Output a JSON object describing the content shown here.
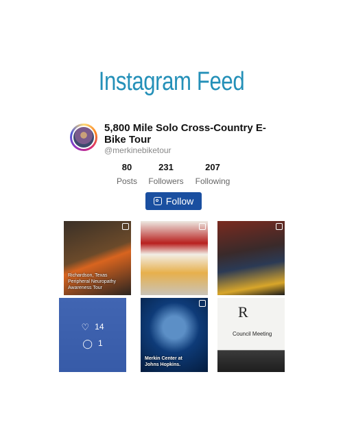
{
  "feed": {
    "title": "Instagram Feed"
  },
  "profile": {
    "name": "5,800 Mile Solo Cross-Country E-Bike Tour",
    "handle": "@merkinebiketour",
    "avatar_icon": "profile-avatar"
  },
  "stats": [
    {
      "value": "80",
      "label": "Posts"
    },
    {
      "value": "231",
      "label": "Followers"
    },
    {
      "value": "207",
      "label": "Following"
    }
  ],
  "follow_button": {
    "label": "Follow",
    "icon": "instagram-icon"
  },
  "posts": [
    {
      "caption": "Richardson, Texas\nPeripheral Neuropathy\nAwareness Tour"
    },
    {
      "caption": ""
    },
    {
      "caption": ""
    },
    {
      "caption": "",
      "likes": "14",
      "comments": "1"
    },
    {
      "caption": "Merkin Center at\nJohns Hopkins."
    },
    {
      "caption": "Council Meeting"
    }
  ]
}
